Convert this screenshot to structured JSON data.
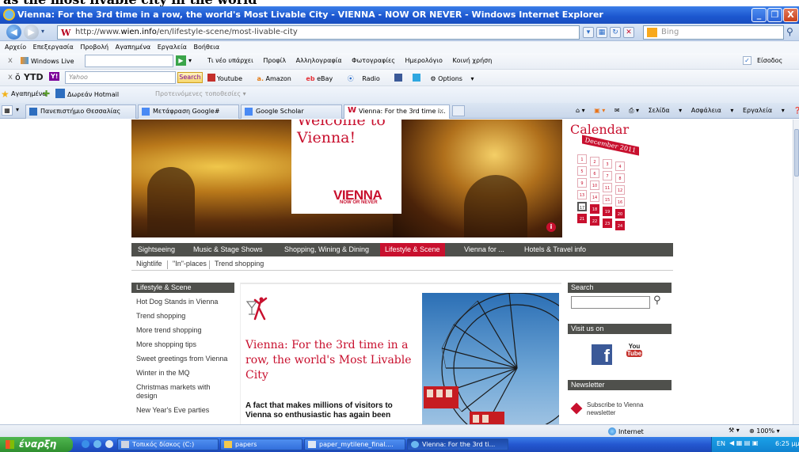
{
  "banner_text": "as the most livable city in the world",
  "window": {
    "title": "Vienna: For the 3rd time in a row, the world's Most Livable City - VIENNA - NOW OR NEVER - Windows Internet Explorer",
    "minimize": "_",
    "restore": "❐",
    "close": "X"
  },
  "address": {
    "url_prefix": "http://www.",
    "url_domain": "wien.info",
    "url_rest": "/en/lifestyle-scene/most-livable-city",
    "search_placeholder": "Bing"
  },
  "menu": [
    "Αρχείο",
    "Επεξεργασία",
    "Προβολή",
    "Αγαπημένα",
    "Εργαλεία",
    "Βοήθεια"
  ],
  "windows_live": {
    "label": "Windows Live",
    "links": [
      "Τι νέο υπάρχει",
      "Προφίλ",
      "Αλληλογραφία",
      "Φωτογραφίες",
      "Ημερολόγιο",
      "Κοινή χρήση"
    ],
    "signin": "Είσοδος"
  },
  "ytd": {
    "label": "YTD",
    "yahoo_placeholder": "Yahoo",
    "search_button": "Search",
    "youtube": "Youtube",
    "amazon": "Amazon",
    "ebay": "eBay",
    "radio": "Radio",
    "options": "Options"
  },
  "favorites": {
    "label": "Αγαπημένα",
    "hotmail": "Δωρεάν Hotmail",
    "suggested": "Προτεινόμενες τοποθεσίες"
  },
  "tabs": [
    {
      "label": "Πανεπιστήμιο Θεσσαλίας",
      "color": "#2e6ebf"
    },
    {
      "label": "Μετάφραση Google#",
      "color": "#4a8af4"
    },
    {
      "label": "Google Scholar",
      "color": "#4a8af4"
    },
    {
      "label": "Vienna: For the 3rd time i...",
      "color": "#c8102e"
    }
  ],
  "commands": [
    "Σελίδα",
    "Ασφάλεια",
    "Εργαλεία"
  ],
  "site": {
    "hero": {
      "welcome_line1": "Welcome to",
      "welcome_line2": "Vienna!",
      "logo": "VIENNA",
      "logo_sub": "NOW OR NEVER"
    },
    "calendar": {
      "title": "Calendar",
      "month": "December 2011",
      "days": [
        "1",
        "2",
        "3",
        "4",
        "5",
        "6",
        "7",
        "8",
        "9",
        "10",
        "11",
        "12",
        "13",
        "14",
        "15",
        "16",
        "17",
        "18",
        "19",
        "20",
        "21",
        "22",
        "23",
        "24"
      ]
    },
    "nav": [
      "Sightseeing",
      "Music & Stage Shows",
      "Shopping, Wining & Dining",
      "Lifestyle & Scene",
      "Vienna for ...",
      "Hotels & Travel info"
    ],
    "subnav": [
      "Nightlife",
      "\"In\"-places",
      "Trend shopping"
    ],
    "sidebar": {
      "heading": "Lifestyle & Scene",
      "items": [
        "Hot Dog Stands in Vienna",
        "Trend shopping",
        "More trend shopping",
        "More shopping tips",
        "Sweet greetings from Vienna",
        "Winter in the MQ",
        "Christmas markets with design",
        "New Year's Eve parties"
      ]
    },
    "article": {
      "title": "Vienna: For the 3rd time in a row, the world's Most Livable City",
      "lead": "A fact that makes millions of visitors to Vienna so enthusiastic has again been"
    },
    "right": {
      "search_heading": "Search",
      "visit_heading": "Visit us on",
      "facebook": "f",
      "youtube_top": "You",
      "youtube_bottom": "Tube",
      "newsletter_heading": "Newsletter",
      "newsletter_text": "Subscribe to Vienna newsletter"
    }
  },
  "status": {
    "zone": "Internet",
    "zoom": "100%"
  },
  "taskbar": {
    "start": "έναρξη",
    "buttons": [
      "Τοπικός δίσκος (C:)",
      "papers",
      "paper_mytilene_final....",
      "Vienna: For the 3rd ti..."
    ],
    "lang": "EN",
    "clock": "6:25 μμ"
  }
}
